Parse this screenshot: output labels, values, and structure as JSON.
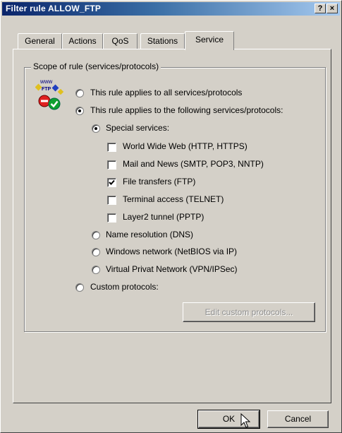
{
  "window": {
    "title": "Filter rule ALLOW_FTP",
    "help_button": "?",
    "close_button": "×"
  },
  "tabs": [
    {
      "label": "General"
    },
    {
      "label": "Actions"
    },
    {
      "label": "QoS"
    },
    {
      "label": "Stations"
    },
    {
      "label": "Service",
      "active": true
    }
  ],
  "group": {
    "label": "Scope of rule (services/protocols)",
    "icon_text": "www",
    "icon_ftp": "FTP"
  },
  "options": {
    "all_services": {
      "label": "This rule applies to all services/protocols",
      "selected": false
    },
    "following_services": {
      "label": "This rule applies to the following services/protocols:",
      "selected": true
    },
    "special_services": {
      "label": "Special services:",
      "selected": true
    },
    "checkboxes": [
      {
        "label": "World Wide Web (HTTP, HTTPS)",
        "checked": false
      },
      {
        "label": "Mail and News (SMTP, POP3, NNTP)",
        "checked": false
      },
      {
        "label": "File transfers (FTP)",
        "checked": true
      },
      {
        "label": "Terminal access (TELNET)",
        "checked": false
      },
      {
        "label": "Layer2 tunnel (PPTP)",
        "checked": false
      }
    ],
    "name_resolution": {
      "label": "Name resolution (DNS)",
      "selected": false
    },
    "windows_network": {
      "label": "Windows network (NetBIOS via IP)",
      "selected": false
    },
    "vpn": {
      "label": "Virtual Privat Network (VPN/IPSec)",
      "selected": false
    },
    "custom_protocols": {
      "label": "Custom protocols:",
      "selected": false
    }
  },
  "buttons": {
    "edit_custom": "Edit custom protocols...",
    "ok": "OK",
    "cancel": "Cancel"
  },
  "colors": {
    "titlebar_start": "#0a246a",
    "titlebar_end": "#a6caf0",
    "face": "#d4d0c8"
  }
}
